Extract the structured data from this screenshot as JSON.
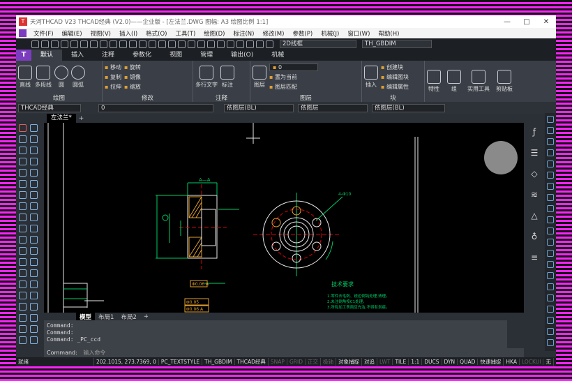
{
  "window": {
    "title": "天河THCAD V23 THCAD经典 (V2.0)——企业版 - [左法兰.DWG 图幅: A3 绘图比例 1:1]",
    "controls": [
      "—",
      "□",
      "✕"
    ]
  },
  "menu": [
    "文件(F)",
    "编辑(E)",
    "视图(V)",
    "插入(I)",
    "格式(O)",
    "工具(T)",
    "绘图(D)",
    "标注(N)",
    "修改(M)",
    "参数(P)",
    "机械(J)",
    "窗口(W)",
    "帮助(H)"
  ],
  "quickbar": {
    "view_combo": "2D线框",
    "dim_combo": "TH_GBDIM"
  },
  "ribbon_tabs": [
    "默认",
    "插入",
    "注释",
    "参数化",
    "视图",
    "管理",
    "输出(O)",
    "机械"
  ],
  "ribbon": {
    "draw": {
      "title": "绘图",
      "tools": [
        "直线",
        "多段线",
        "圆",
        "圆弧"
      ]
    },
    "modify": {
      "title": "修改",
      "tools": [
        "移动",
        "旋转",
        "复制",
        "镜像",
        "拉伸",
        "缩放"
      ]
    },
    "annotate": {
      "title": "注释",
      "tools": [
        "多行文字",
        "标注"
      ]
    },
    "layer": {
      "title": "图层",
      "tools": [
        "图层",
        "置为当前",
        "图层匹配"
      ],
      "combo": "0"
    },
    "block": {
      "title": "块",
      "tools": [
        "插入",
        "创建块",
        "编辑图块",
        "编辑属性"
      ]
    },
    "props": [
      "特性",
      "组",
      "实用工具",
      "剪贴板"
    ]
  },
  "propbar": {
    "style": "THCAD经典",
    "layer": "0",
    "color": "依图层(BL)",
    "linetype": "依图层",
    "lineweight": "依图层(BL)"
  },
  "doc_tab": "左法兰*",
  "layout_tabs": [
    "模型",
    "布局1",
    "布局2",
    "+"
  ],
  "drawing": {
    "section_label": "A—A",
    "tech_title": "技术要求",
    "tech_lines": [
      "1.零件去毛刺、锐边倒钝处理,清理。",
      "2.未注倒角按C1处理。",
      "3.所有加工表面应光洁,不得有划痕。"
    ],
    "dims": [
      "4-Φ10",
      "Φ0.06 A",
      "Φ0.05",
      "Φ0.06 A"
    ]
  },
  "command": {
    "history": [
      "Command:",
      "Command:",
      "Command: _PC_ccd"
    ],
    "prompt": "Command:",
    "placeholder": "输入命令"
  },
  "status": {
    "mode": "就绪",
    "coords": "202.1015, 273.7369, 0",
    "items": [
      "PC_TEXTSTYLE",
      "TH_GBDIM",
      "THCAD经典",
      "SNAP",
      "GRID",
      "正交",
      "极轴",
      "对象捕捉",
      "对追",
      "DUCS",
      "DYN",
      "LWT",
      "TILE",
      "1:1",
      "DUCS",
      "DYN",
      "QUAD",
      "快速捕捉",
      "HKA",
      "LOCKUI",
      "无"
    ]
  },
  "colors": {
    "accent": "#7c3cbf",
    "canvas": "#000000",
    "frame": "#ff22ff"
  }
}
